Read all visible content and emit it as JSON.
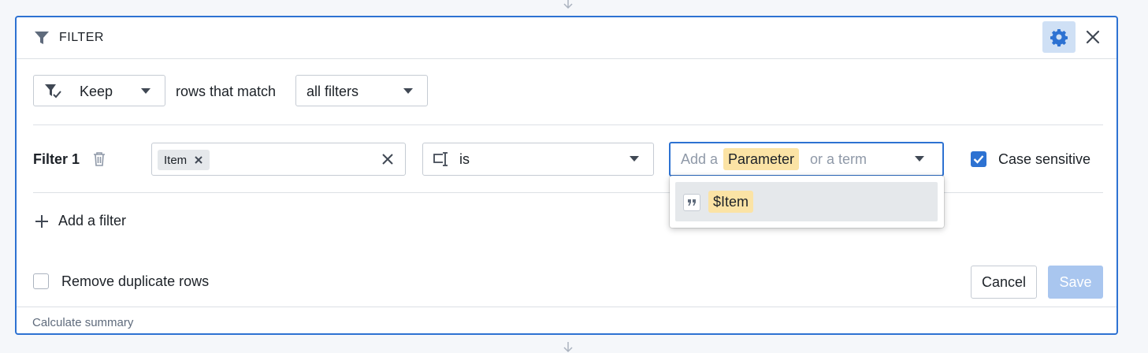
{
  "header": {
    "title": "FILTER",
    "icons": {
      "filter": "filter-icon",
      "gear": "gear-icon",
      "close": "close-icon"
    }
  },
  "mode_row": {
    "keep_select": "Keep",
    "rows_that_match_label": "rows that match",
    "match_select": "all filters"
  },
  "filters": [
    {
      "label": "Filter 1",
      "column_chip": "Item",
      "operator": "is",
      "value_placeholder_prefix": "Add a",
      "value_parameter_tag": "Parameter",
      "value_placeholder_suffix": "or a term",
      "case_sensitive_label": "Case sensitive",
      "case_sensitive_checked": true
    }
  ],
  "dropdown": {
    "items": [
      {
        "icon": "quote-icon",
        "label": "$Item"
      }
    ]
  },
  "add_filter_label": "Add a filter",
  "remove_duplicates_label": "Remove duplicate rows",
  "remove_duplicates_checked": false,
  "buttons": {
    "cancel": "Cancel",
    "save": "Save"
  },
  "footer": {
    "summary_label": "Calculate summary"
  },
  "colors": {
    "accent": "#2d72d2",
    "parameter_highlight": "#fbe3a5",
    "save_disabled": "#a9c6ef"
  }
}
